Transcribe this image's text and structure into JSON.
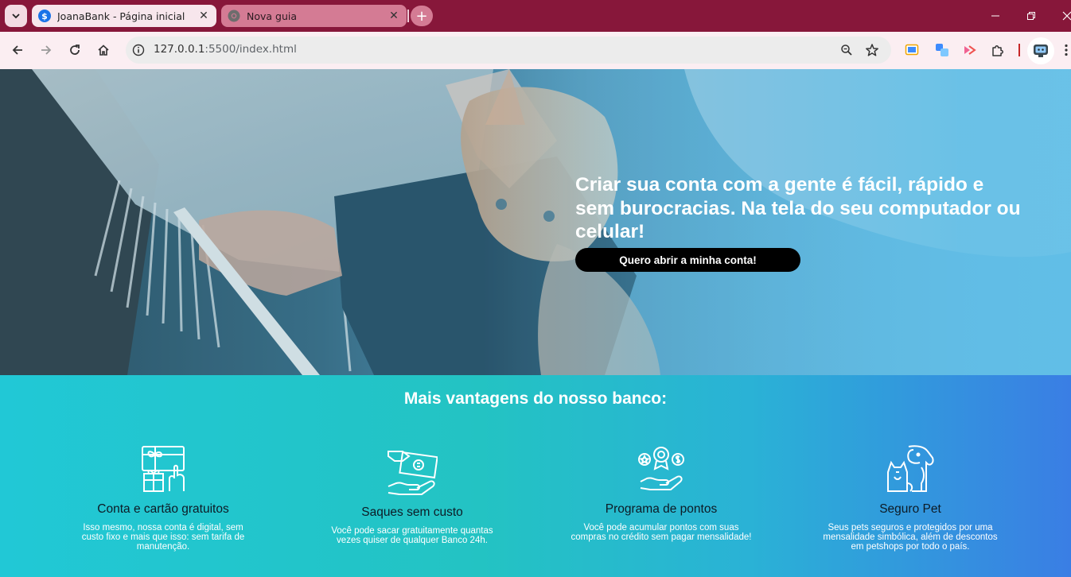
{
  "browser": {
    "tabs": [
      {
        "title": "JoanaBank - Página inicial",
        "favicon": "dollar-icon",
        "active": true
      },
      {
        "title": "Nova guia",
        "favicon": "chrome-icon",
        "active": false
      }
    ],
    "url_host": "127.0.0.1",
    "url_rest": ":5500/index.html",
    "colors": {
      "frame": "#87173a",
      "toolbar": "#fbeef2",
      "tab_active": "#f7e6ec",
      "tab_inactive": "#d47b94"
    }
  },
  "hero": {
    "headline": "Criar sua conta com a gente é fácil, rápido e sem burocracias. Na tela do seu computador ou celular!",
    "cta_label": "Quero abrir a minha conta!"
  },
  "benefits": {
    "title": "Mais vantagens do nosso banco:",
    "items": [
      {
        "icon": "gift-card-icon",
        "title": "Conta e cartão gratuitos",
        "desc": "Isso mesmo, nossa conta é digital, sem custo fixo e mais que isso: sem tarifa de manutenção."
      },
      {
        "icon": "cash-hand-icon",
        "title": "Saques sem custo",
        "desc": "Você pode sacar gratuitamente quantas vezes quiser de qualquer Banco 24h."
      },
      {
        "icon": "rewards-hand-icon",
        "title": "Programa de pontos",
        "desc": "Você pode acumular pontos com suas compras no crédito sem pagar mensalidade!"
      },
      {
        "icon": "pets-icon",
        "title": "Seguro Pet",
        "desc": "Seus pets seguros e protegidos por uma mensalidade simbólica, além de descontos em petshops por todo o país."
      }
    ]
  }
}
